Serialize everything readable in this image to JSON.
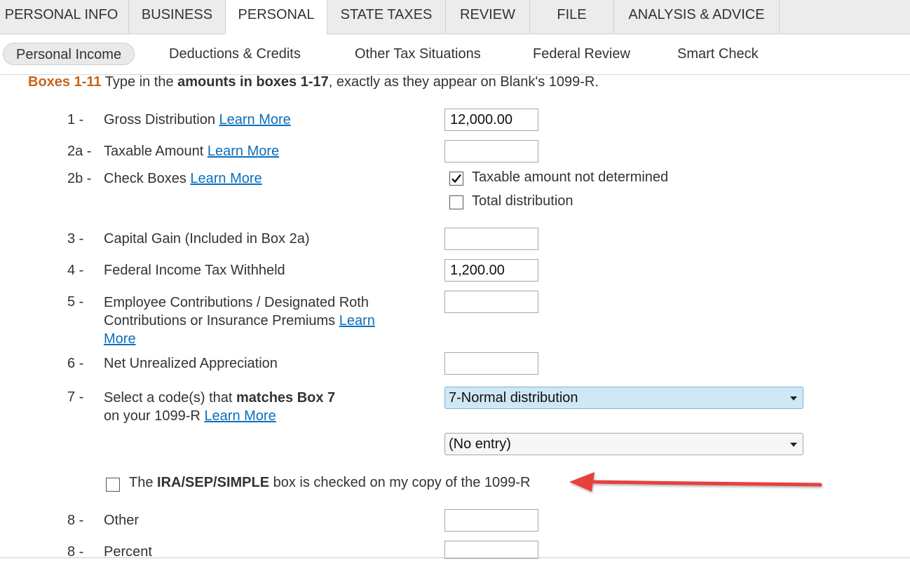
{
  "top_tabs": [
    {
      "label": "PERSONAL INFO"
    },
    {
      "label": "BUSINESS"
    },
    {
      "label": "PERSONAL"
    },
    {
      "label": "STATE TAXES"
    },
    {
      "label": "REVIEW"
    },
    {
      "label": "FILE"
    },
    {
      "label": "ANALYSIS & ADVICE"
    }
  ],
  "sub_tabs": [
    {
      "label": "Personal Income"
    },
    {
      "label": "Deductions & Credits"
    },
    {
      "label": "Other Tax Situations"
    },
    {
      "label": "Federal Review"
    },
    {
      "label": "Smart Check"
    }
  ],
  "intro": {
    "lead": "Boxes 1-11",
    "part1": "Type in the",
    "bold": "amounts in boxes 1-17",
    "part2": ", exactly as they appear on Blank's 1099-R."
  },
  "learn_more": "Learn More",
  "box1": {
    "num": "1 -",
    "label": "Gross Distribution",
    "value": "12,000.00"
  },
  "box2a": {
    "num": "2a -",
    "label": "Taxable Amount",
    "value": ""
  },
  "box2b": {
    "num": "2b -",
    "label": "Check Boxes",
    "opt1": "Taxable amount not determined",
    "opt1_checked": true,
    "opt2": "Total distribution",
    "opt2_checked": false
  },
  "box3": {
    "num": "3 -",
    "label": "Capital Gain (Included in Box 2a)",
    "value": ""
  },
  "box4": {
    "num": "4 -",
    "label": "Federal Income Tax Withheld",
    "value": "1,200.00"
  },
  "box5": {
    "num": "5 -",
    "label_line1": "Employee Contributions / Designated Roth",
    "label_line2": "Contributions or Insurance Premiums",
    "learn_a": "Learn",
    "learn_b": "More",
    "value": ""
  },
  "box6": {
    "num": "6 -",
    "label": "Net Unrealized Appreciation",
    "value": ""
  },
  "box7": {
    "num": "7 -",
    "label_part1": "Select a code(s) that",
    "label_bold": "matches Box 7",
    "label_line2": "on your 1099-R",
    "select1": "7-Normal distribution",
    "select2": "(No entry)"
  },
  "ira": {
    "pre": "The",
    "bold": "IRA/SEP/SIMPLE",
    "post": "box is checked on my copy of the 1099-R",
    "checked": false
  },
  "box8a": {
    "num": "8 -",
    "label": "Other",
    "value": ""
  },
  "box8b": {
    "num": "8 -",
    "label": "Percent",
    "value": ""
  },
  "colors": {
    "accent_orange": "#c8651b",
    "link_blue": "#0b6fbd",
    "arrow_red": "#e8413c"
  }
}
